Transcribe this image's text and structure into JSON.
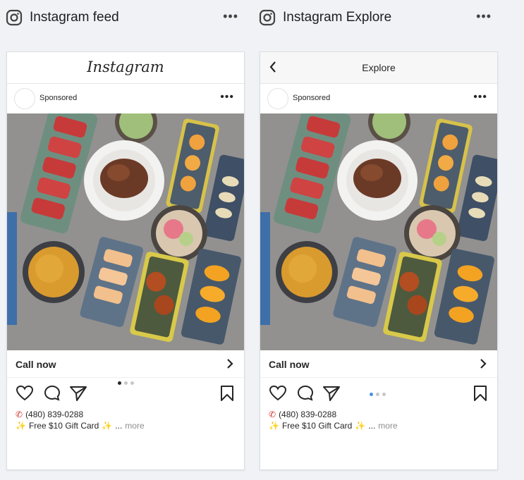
{
  "columns": [
    {
      "title": "Instagram feed",
      "more_label": "•••",
      "topbar": {
        "logo_text": "Instagram"
      },
      "post": {
        "sponsored_label": "Sponsored",
        "menu_label": "•••",
        "cta_label": "Call now",
        "carousel": {
          "count": 3,
          "active": 0,
          "active_color": "#262626"
        },
        "phone_line": "(480) 839-0288",
        "promo_line": "Free $10 Gift Card",
        "ellipsis": "...",
        "more_link": "more"
      }
    },
    {
      "title": "Instagram Explore",
      "more_label": "•••",
      "topbar": {
        "title": "Explore"
      },
      "post": {
        "sponsored_label": "Sponsored",
        "menu_label": "•••",
        "cta_label": "Call now",
        "carousel": {
          "count": 3,
          "active": 0,
          "active_color": "#4a90e2"
        },
        "phone_line": "(480) 839-0288",
        "promo_line": "Free $10 Gift Card",
        "ellipsis": "...",
        "more_link": "more"
      }
    }
  ],
  "icons": {
    "platform": "instagram-icon",
    "phone": "telephone-receiver-icon",
    "sparkle": "sparkles-icon"
  },
  "colors": {
    "background": "#f0f2f5",
    "text": "#262626",
    "muted": "#8e8e8e"
  }
}
